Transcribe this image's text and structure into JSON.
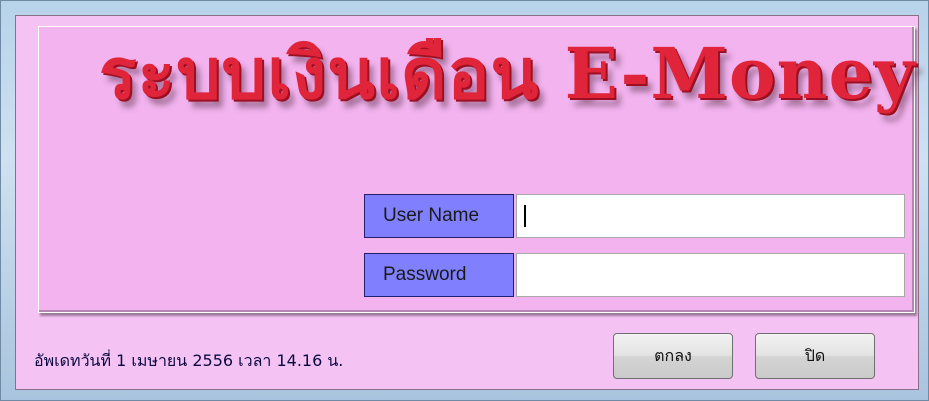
{
  "dialog": {
    "title": "ระบบเงินเดือน E-Money"
  },
  "form": {
    "username": {
      "label": "User Name",
      "value": ""
    },
    "password": {
      "label": "Password",
      "value": ""
    }
  },
  "status": {
    "text": "อัพเดทวันที่ 1 เมษายน 2556 เวลา 14.16 น."
  },
  "buttons": {
    "ok_label": "ตกลง",
    "close_label": "ปิด"
  },
  "colors": {
    "dialog_bg": "#f5c3f3",
    "label_bg": "#8080ff",
    "title_color": "#e0243a"
  }
}
